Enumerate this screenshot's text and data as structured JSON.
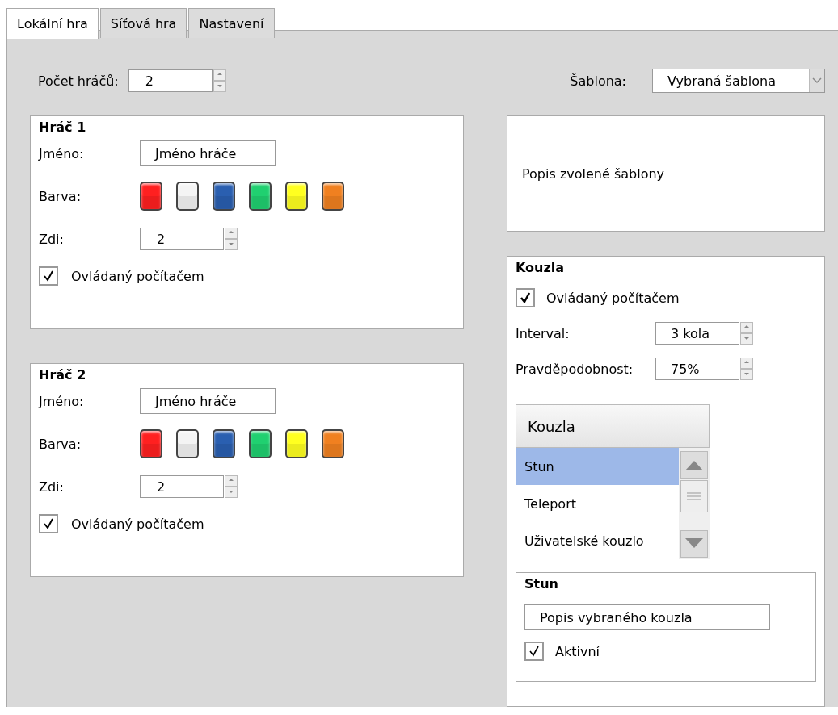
{
  "tabs": [
    {
      "label": "Lokální hra",
      "selected": true
    },
    {
      "label": "Síťová hra",
      "selected": false
    },
    {
      "label": "Nastavení",
      "selected": false
    }
  ],
  "player_count": {
    "label": "Počet hráčů:",
    "value": "2"
  },
  "template": {
    "label": "Šablona:",
    "value": "Vybraná šablona",
    "description": "Popis zvolené šablony"
  },
  "players": [
    {
      "title": "Hráč 1",
      "name_label": "Jméno:",
      "name_value": "Jméno hráče",
      "color_label": "Barva:",
      "colors": [
        {
          "color": "#ff2020"
        },
        {
          "color": "#f4f4f4"
        },
        {
          "color": "#2a5fb0"
        },
        {
          "color": "#20d070"
        },
        {
          "color": "#ffff20"
        },
        {
          "color": "#f08020"
        }
      ],
      "walls_label": "Zdi:",
      "walls_value": "2",
      "computer": {
        "label": "Ovládaný počítačem",
        "checked": true
      }
    },
    {
      "title": "Hráč 2",
      "name_label": "Jméno:",
      "name_value": "Jméno hráče",
      "color_label": "Barva:",
      "colors": [
        {
          "color": "#ff2020"
        },
        {
          "color": "#f4f4f4"
        },
        {
          "color": "#2a5fb0"
        },
        {
          "color": "#20d070"
        },
        {
          "color": "#ffff20"
        },
        {
          "color": "#f08020"
        }
      ],
      "walls_label": "Zdi:",
      "walls_value": "2",
      "computer": {
        "label": "Ovládaný počítačem",
        "checked": true
      }
    }
  ],
  "spells": {
    "title": "Kouzla",
    "computer": {
      "label": "Ovládaný počítačem",
      "checked": true
    },
    "interval_label": "Interval:",
    "interval_value": "3 kola",
    "probability_label": "Pravděpodobnost:",
    "probability_value": "75%",
    "list_header": "Kouzla",
    "items": [
      {
        "label": "Stun",
        "selected": true
      },
      {
        "label": "Teleport",
        "selected": false
      },
      {
        "label": "Uživatelské kouzlo",
        "selected": false
      }
    ],
    "detail": {
      "title": "Stun",
      "description": "Popis vybraného kouzla",
      "active": {
        "label": "Aktivní",
        "checked": true
      }
    }
  }
}
